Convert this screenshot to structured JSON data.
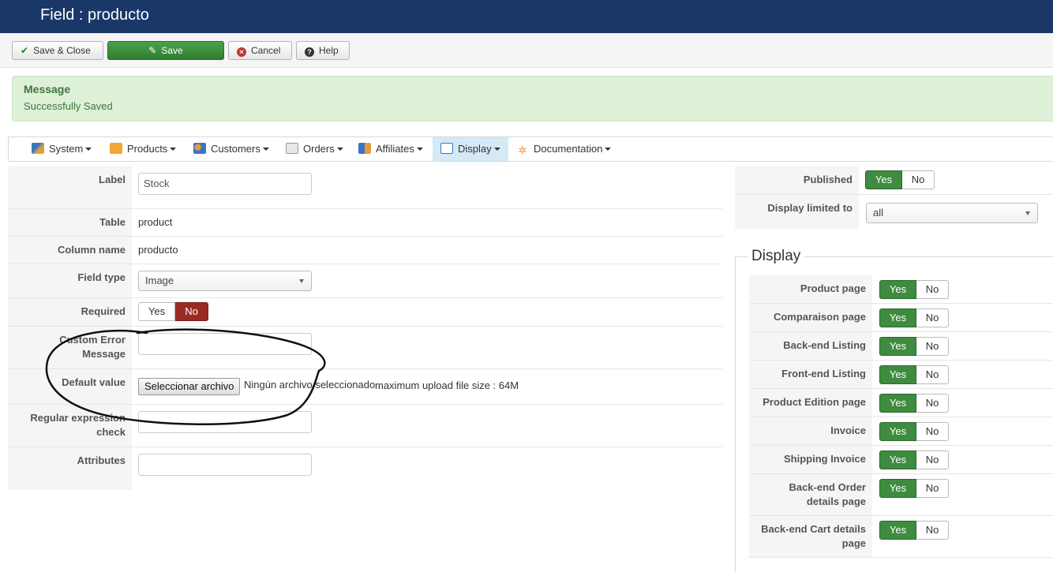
{
  "window": {
    "title": "Field : producto"
  },
  "toolbar": {
    "save_close": "Save & Close",
    "save": "Save",
    "cancel": "Cancel",
    "help": "Help"
  },
  "message": {
    "heading": "Message",
    "text": "Successfully Saved"
  },
  "menu": {
    "system": "System",
    "products": "Products",
    "customers": "Customers",
    "orders": "Orders",
    "affiliates": "Affiliates",
    "display": "Display",
    "documentation": "Documentation"
  },
  "form": {
    "label": {
      "label": "Label",
      "value": "Stock"
    },
    "table": {
      "label": "Table",
      "value": "product"
    },
    "column_name": {
      "label": "Column name",
      "value": "producto"
    },
    "field_type": {
      "label": "Field type",
      "value": "Image"
    },
    "required": {
      "label": "Required",
      "yes": "Yes",
      "no": "No",
      "selected": "No"
    },
    "custom_error": {
      "label_line1": "Custom Error",
      "label_line2": "Message",
      "value": ""
    },
    "default_value": {
      "label": "Default value",
      "button": "Seleccionar archivo",
      "status": "Ningún archivo seleccionado",
      "note": "maximum upload file size : 64M"
    },
    "regex": {
      "label_line1": "Regular expression",
      "label_line2": "check",
      "value": ""
    },
    "attributes": {
      "label": "Attributes",
      "value": ""
    }
  },
  "side": {
    "published": {
      "label": "Published",
      "yes": "Yes",
      "no": "No",
      "selected": "Yes"
    },
    "display_limited": {
      "label": "Display limited to",
      "value": "all"
    }
  },
  "display_section": {
    "legend": "Display",
    "rows": [
      {
        "label1": "Product page",
        "label2": "",
        "yes": "Yes",
        "no": "No",
        "selected": "Yes"
      },
      {
        "label1": "Comparaison page",
        "label2": "",
        "yes": "Yes",
        "no": "No",
        "selected": "Yes"
      },
      {
        "label1": "Back-end Listing",
        "label2": "",
        "yes": "Yes",
        "no": "No",
        "selected": "Yes"
      },
      {
        "label1": "Front-end Listing",
        "label2": "",
        "yes": "Yes",
        "no": "No",
        "selected": "Yes"
      },
      {
        "label1": "Product Edition page",
        "label2": "",
        "yes": "Yes",
        "no": "No",
        "selected": "Yes"
      },
      {
        "label1": "Invoice",
        "label2": "",
        "yes": "Yes",
        "no": "No",
        "selected": "Yes"
      },
      {
        "label1": "Shipping Invoice",
        "label2": "",
        "yes": "Yes",
        "no": "No",
        "selected": "Yes"
      },
      {
        "label1": "Back-end Order",
        "label2": "details page",
        "yes": "Yes",
        "no": "No",
        "selected": "Yes"
      },
      {
        "label1": "Back-end Cart details",
        "label2": "page",
        "yes": "Yes",
        "no": "No",
        "selected": "Yes"
      }
    ]
  },
  "colors": {
    "header_bg": "#1a3867",
    "save_green": "#3f8b3f",
    "no_red": "#9b2a22",
    "message_bg": "#dff0d8",
    "menu_active": "#d5e9f6"
  }
}
